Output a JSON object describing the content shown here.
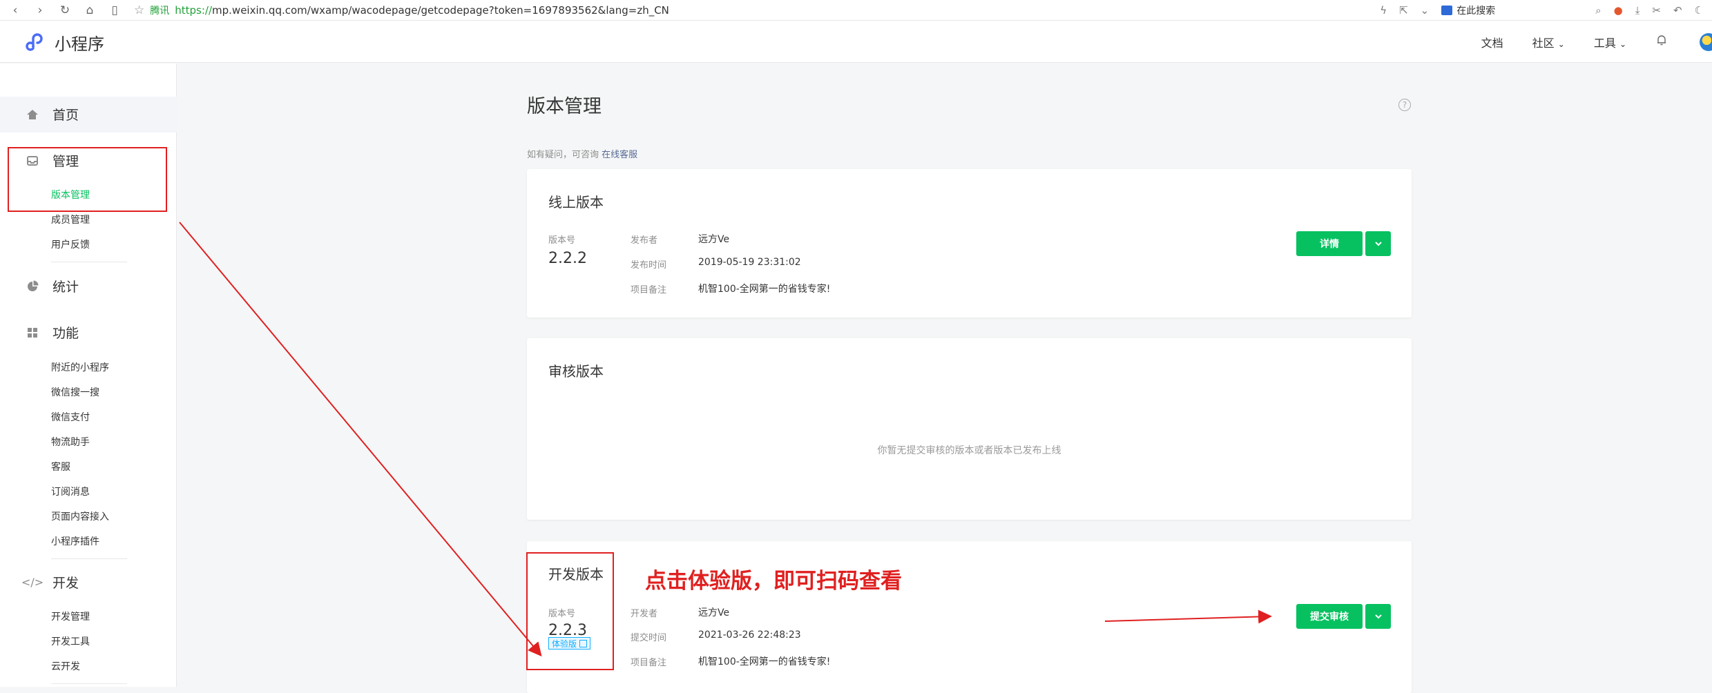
{
  "browser": {
    "provider_label": "腾讯",
    "url_scheme": "https://",
    "url_rest": "mp.weixin.qq.com/wxamp/wacodepage/getcodepage?token=1697893562&lang=zh_CN",
    "search_placeholder": "在此搜索"
  },
  "header": {
    "logo_text": "小程序",
    "nav_docs": "文档",
    "nav_community": "社区",
    "nav_tools": "工具"
  },
  "sidebar": {
    "home": "首页",
    "manage": "管理",
    "manage_items": [
      "版本管理",
      "成员管理",
      "用户反馈"
    ],
    "stats": "统计",
    "features": "功能",
    "feature_items": [
      "附近的小程序",
      "微信搜一搜",
      "微信支付",
      "物流助手",
      "客服",
      "订阅消息",
      "页面内容接入",
      "小程序插件"
    ],
    "dev": "开发",
    "dev_items": [
      "开发管理",
      "开发工具",
      "云开发"
    ]
  },
  "main": {
    "title": "版本管理",
    "help_icon": "?",
    "consult_prefix": "如有疑问，可咨询",
    "consult_link": "在线客服",
    "online": {
      "title": "线上版本",
      "version_label": "版本号",
      "version": "2.2.2",
      "publisher_label": "发布者",
      "publisher": "远方Ve",
      "time_label": "发布时间",
      "time": "2019-05-19 23:31:02",
      "note_label": "项目备注",
      "note": "机智100-全网第一的省钱专家!",
      "detail_button": "详情"
    },
    "review": {
      "title": "审核版本",
      "empty_text": "你暂无提交审核的版本或者版本已发布上线"
    },
    "dev": {
      "title": "开发版本",
      "version_label": "版本号",
      "version": "2.2.3",
      "trial_tag": "体验版",
      "dev_label": "开发者",
      "dev": "远方Ve",
      "submit_time_label": "提交时间",
      "submit_time": "2021-03-26 22:48:23",
      "note_label": "项目备注",
      "note": "机智100-全网第一的省钱专家!",
      "submit_button": "提交审核"
    }
  },
  "annotation": {
    "text": "点击体验版，即可扫码查看",
    "color": "#e02020"
  },
  "colors": {
    "accent_green": "#07c160",
    "link_blue": "#576b95"
  }
}
